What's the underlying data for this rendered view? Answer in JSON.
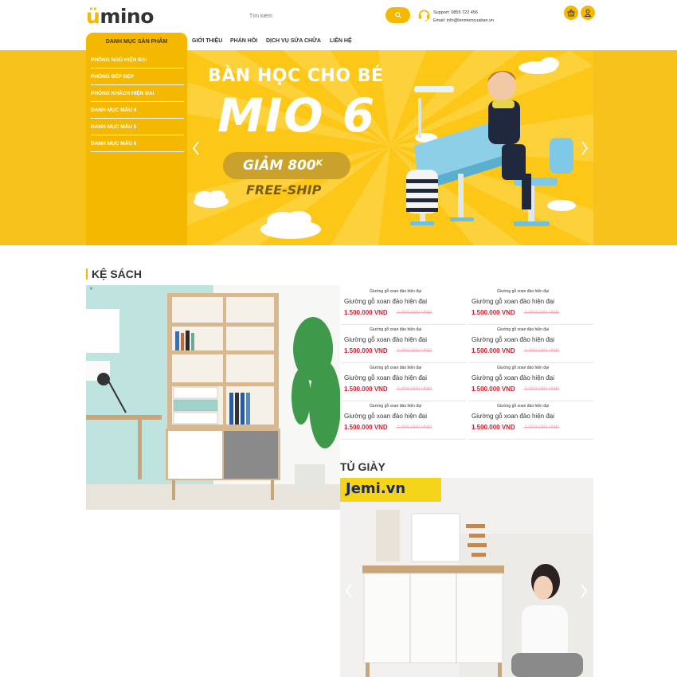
{
  "header": {
    "logo": "umino",
    "search_placeholder": "Tìm kiếm",
    "support_line": "Support: 0855 722 456",
    "email_line": "Email: info@lenmiencuaban.vn"
  },
  "nav": {
    "category_tab": "DANH MỤC SẢN PHẨM",
    "items": [
      "GIỚI THIỆU",
      "PHẢN HỒI",
      "DỊCH VỤ SỬA CHỮA",
      "LIÊN HỆ"
    ]
  },
  "sidebar": {
    "items": [
      "PHÒNG NGỦ HIỆN ĐẠI",
      "PHÒNG BẾP ĐẸP",
      "PHÒNG KHÁCH HIỆN ĐẠI",
      "DANH MỤC MẪU 4",
      "DANH MỤC MẪU 5",
      "DANH MỤC MẪU 6"
    ]
  },
  "banner": {
    "title1": "BÀN HỌC CHO BÉ",
    "title2": "MIO 6",
    "discount": "GIẢM 800ᴷ",
    "freeship": "FREE-SHIP"
  },
  "sections": {
    "ke_sach": "KỆ SÁCH",
    "tu_giay": "TỦ GIÀY",
    "jemi": "Jemi.vn"
  },
  "products": [
    {
      "caption": "Giường gỗ xoan đào hiện đại",
      "name": "Giường gỗ xoan đào hiện đại",
      "price": "1.500.000 VND",
      "old_price": "2.000.000 VND"
    },
    {
      "caption": "Giường gỗ xoan đào hiện đại",
      "name": "Giường gỗ xoan đào hiện đại",
      "price": "1.500.000 VND",
      "old_price": "2.000.000 VND"
    },
    {
      "caption": "Giường gỗ xoan đào hiện đại",
      "name": "Giường gỗ xoan đào hiện đại",
      "price": "1.500.000 VND",
      "old_price": "2.000.000 VND"
    },
    {
      "caption": "Giường gỗ xoan đào hiện đại",
      "name": "Giường gỗ xoan đào hiện đại",
      "price": "1.500.000 VND",
      "old_price": "2.000.000 VND"
    },
    {
      "caption": "Giường gỗ xoan đào hiện đại",
      "name": "Giường gỗ xoan đào hiện đại",
      "price": "1.500.000 VND",
      "old_price": "2.000.000 VND"
    },
    {
      "caption": "Giường gỗ xoan đào hiện đại",
      "name": "Giường gỗ xoan đào hiện đại",
      "price": "1.500.000 VND",
      "old_price": "2.000.000 VND"
    },
    {
      "caption": "Giường gỗ xoan đào hiện đại",
      "name": "Giường gỗ xoan đào hiện đại",
      "price": "1.500.000 VND",
      "old_price": "2.000.000 VND"
    },
    {
      "caption": "Giường gỗ xoan đào hiện đại",
      "name": "Giường gỗ xoan đào hiện đại",
      "price": "1.500.000 VND",
      "old_price": "2.000.000 VND"
    }
  ],
  "colors": {
    "brand": "#f5b800",
    "price": "#e01b2c",
    "old_price": "#f3a8b0"
  }
}
